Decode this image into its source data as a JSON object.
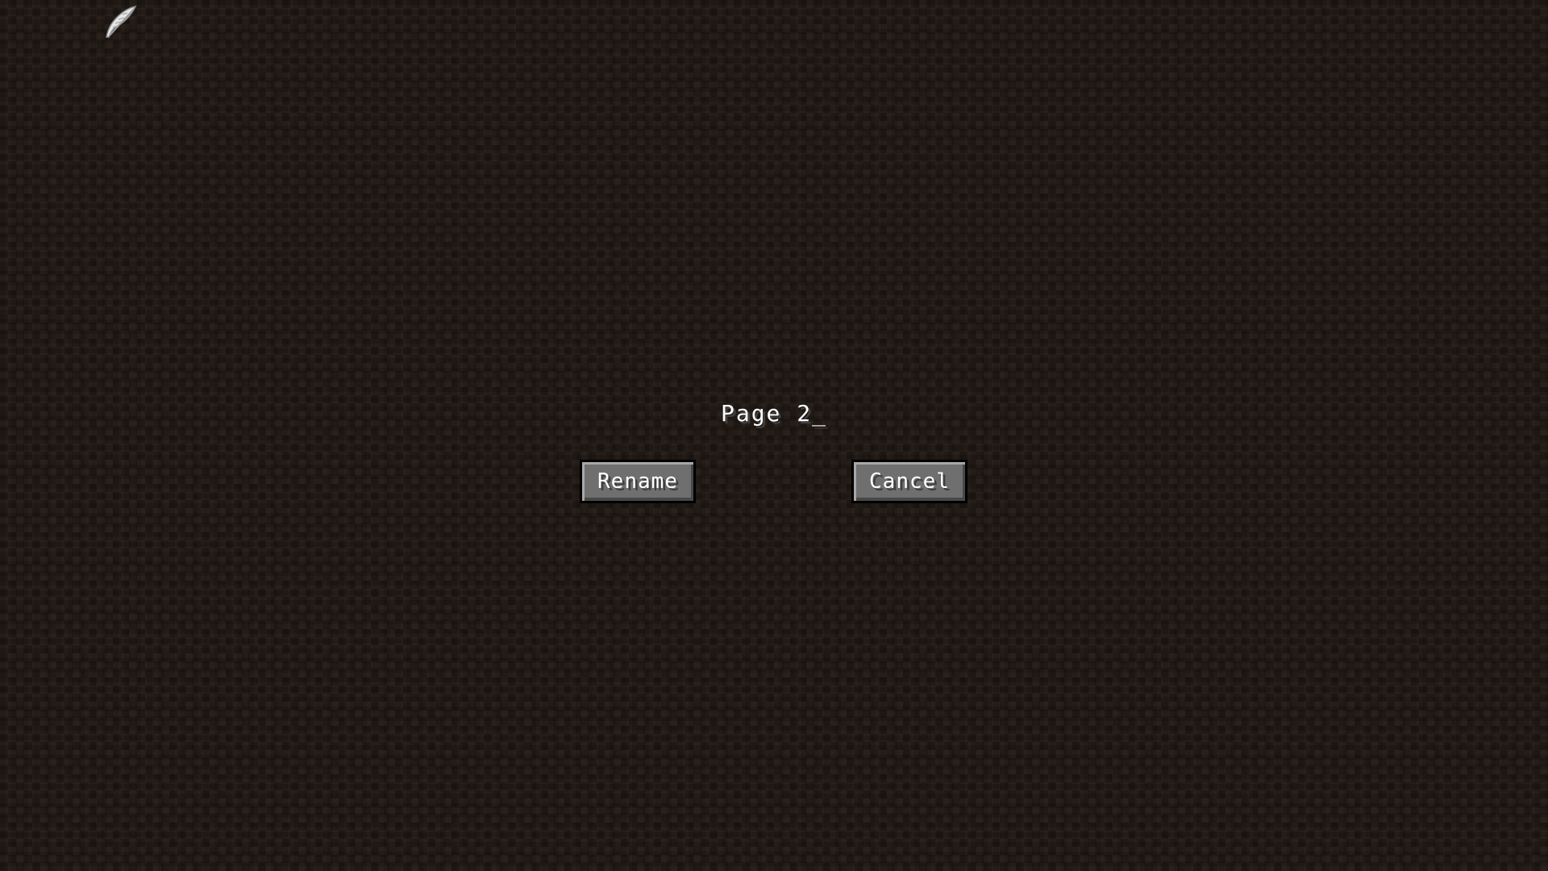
{
  "cursor": {
    "icon": "feather-icon"
  },
  "rename_screen": {
    "title_value": "Page 2_",
    "rename_label": "Rename",
    "cancel_label": "Cancel"
  },
  "colors": {
    "background": "#241c16",
    "button_face": "#6f6f6f",
    "text": "#ffffff"
  }
}
